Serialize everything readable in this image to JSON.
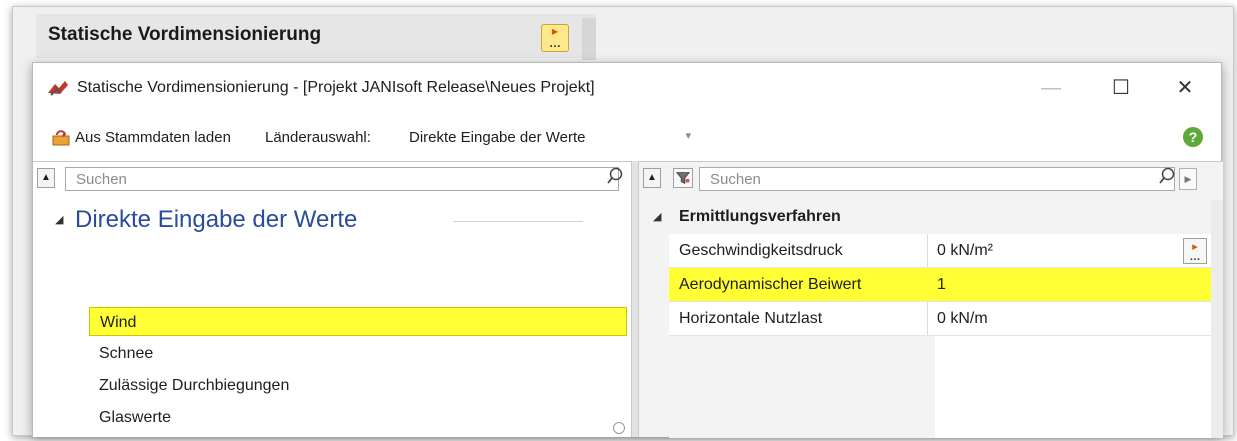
{
  "background_window": {
    "title": "Statische Vordimensionierung",
    "button_icon": "ellipsis-button-icon"
  },
  "dialog": {
    "title": "Statische Vordimensionierung - [Projekt JANIsoft Release\\Neues Projekt]",
    "minimize": "—",
    "maximize": "☐",
    "close": "✕"
  },
  "toolbar": {
    "load_label": "Aus Stammdaten laden",
    "country_label": "Länderauswahl:",
    "country_value": "Direkte Eingabe der Werte",
    "help_icon": "help-icon"
  },
  "left_pane": {
    "search_placeholder": "Suchen",
    "group_title": "Direkte Eingabe der Werte",
    "items": [
      {
        "label": "Wind",
        "selected": true
      },
      {
        "label": "Schnee",
        "selected": false
      },
      {
        "label": "Zulässige Durchbiegungen",
        "selected": false
      },
      {
        "label": "Glaswerte",
        "selected": false
      }
    ]
  },
  "right_pane": {
    "search_placeholder": "Suchen",
    "category_title": "Ermittlungsverfahren",
    "properties": [
      {
        "name": "Geschwindigkeitsdruck",
        "value": "0 kN/m²",
        "has_button": true,
        "highlight": false
      },
      {
        "name": "Aerodynamischer Beiwert",
        "value": "1",
        "has_button": false,
        "highlight": true
      },
      {
        "name": "Horizontale Nutzlast",
        "value": "0 kN/m",
        "has_button": false,
        "highlight": false
      }
    ]
  },
  "colors": {
    "highlight": "#ffff33",
    "group_title": "#2b4c9b",
    "help": "#5fa83a"
  }
}
